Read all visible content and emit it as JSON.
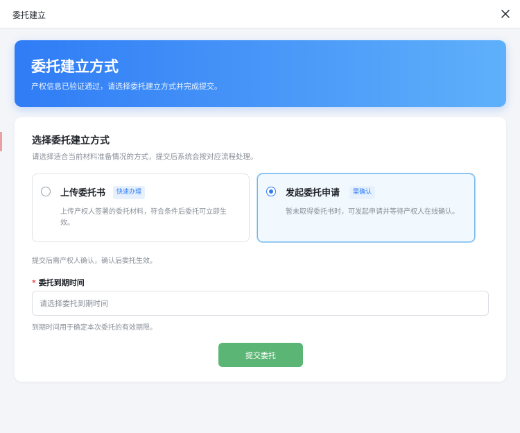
{
  "dialog": {
    "title": "委托建立",
    "close_icon": "close-icon"
  },
  "hero": {
    "title": "委托建立方式",
    "subtitle": "产权信息已验证通过，请选择委托建立方式并完成提交。"
  },
  "form": {
    "section_title": "选择委托建立方式",
    "section_desc": "请选择适合当前材料准备情况的方式，提交后系统会按对应流程处理。",
    "options": [
      {
        "title": "上传委托书",
        "badge": "快速办理",
        "desc": "上传产权人签署的委托材料，符合条件后委托可立即生效。",
        "selected": false
      },
      {
        "title": "发起委托申请",
        "badge": "需确认",
        "desc": "暂未取得委托书时，可发起申请并等待产权人在线确认。",
        "selected": true
      }
    ],
    "note": "提交后需产权人确认，确认后委托生效。",
    "required_mark": "*",
    "expiry_label": "委托到期时间",
    "expiry_value": "",
    "expiry_placeholder": "请选择委托到期时间",
    "expiry_hint": "到期时间用于确定本次委托的有效期限。",
    "submit_label": "提交委托"
  },
  "colors": {
    "accent": "#2f7cf6",
    "submit": "#5bb574",
    "required": "#e5484d"
  }
}
